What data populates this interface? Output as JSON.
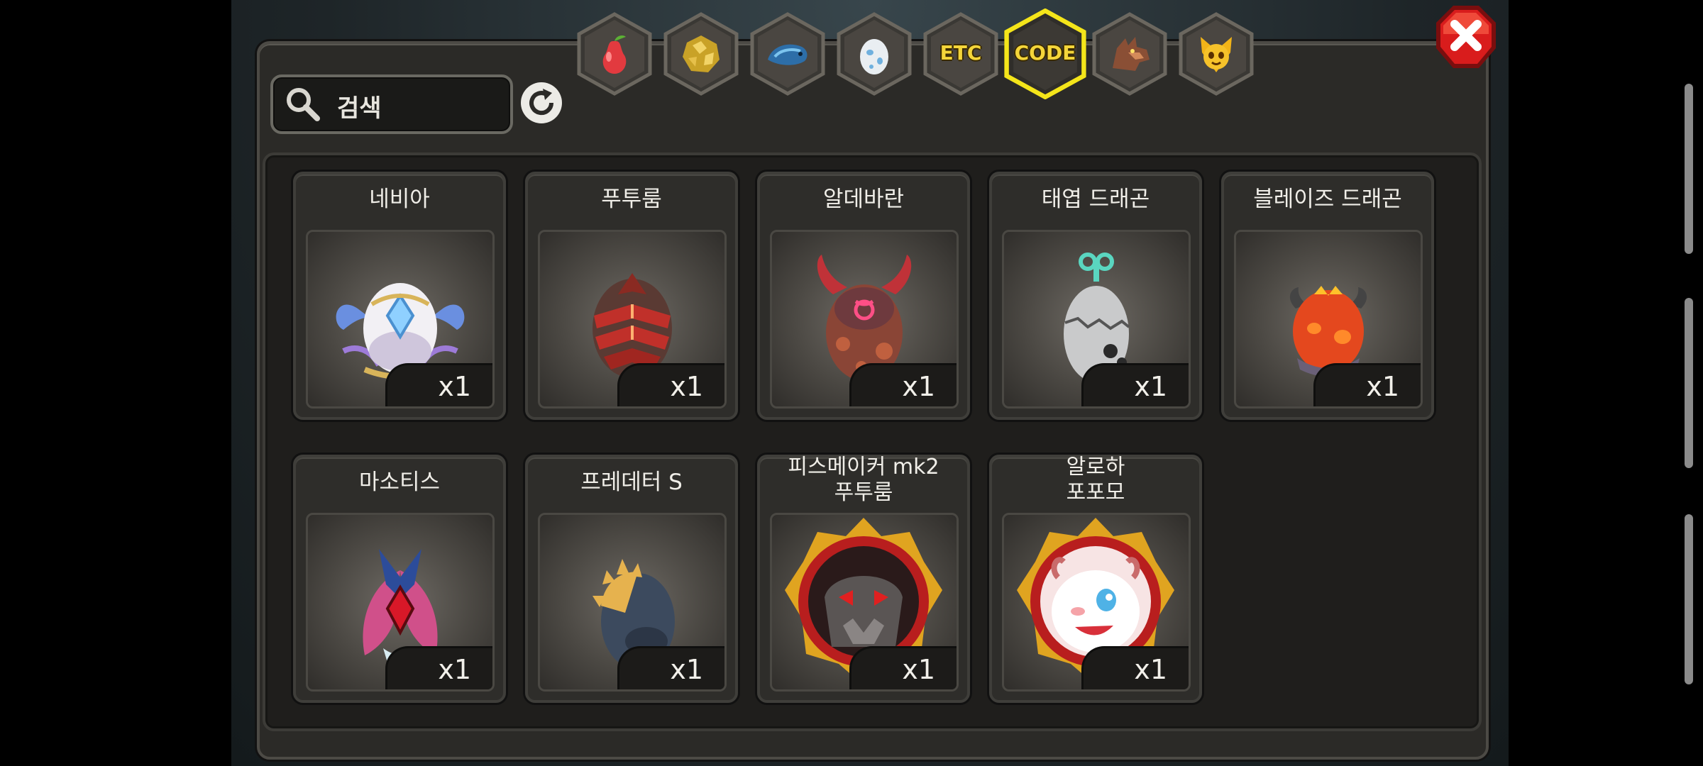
{
  "search": {
    "placeholder": "검색"
  },
  "tabs": [
    {
      "name": "tab-fruit",
      "icon": "pear-fruit-icon",
      "label": ""
    },
    {
      "name": "tab-gold",
      "icon": "gold-ore-icon",
      "label": ""
    },
    {
      "name": "tab-fish",
      "icon": "blue-fish-icon",
      "label": ""
    },
    {
      "name": "tab-egg",
      "icon": "spotted-egg-icon",
      "label": ""
    },
    {
      "name": "tab-etc",
      "icon": "",
      "label": "ETC"
    },
    {
      "name": "tab-code",
      "icon": "",
      "label": "CODE",
      "selected": true
    },
    {
      "name": "tab-dragon",
      "icon": "dragon-head-icon",
      "label": ""
    },
    {
      "name": "tab-creature",
      "icon": "yellow-creature-icon",
      "label": ""
    }
  ],
  "items": [
    {
      "name": "네비아",
      "count": "x1",
      "icon": "winged-crystal-egg"
    },
    {
      "name": "푸투룸",
      "count": "x1",
      "icon": "red-spiked-egg"
    },
    {
      "name": "알데바란",
      "count": "x1",
      "icon": "horned-taurus-egg"
    },
    {
      "name": "태엽 드래곤",
      "count": "x1",
      "icon": "clockwork-egg"
    },
    {
      "name": "블레이즈 드래곤",
      "count": "x1",
      "icon": "flame-dragon-egg"
    },
    {
      "name": "마소티스",
      "count": "x1",
      "icon": "winged-gem-egg"
    },
    {
      "name": "프레데터 S",
      "count": "x1",
      "icon": "spiked-dark-egg"
    },
    {
      "name": "피스메이커 mk2\n푸투룸",
      "count": "x1",
      "icon": "peacemaker-medal"
    },
    {
      "name": "알로하\n포포모",
      "count": "x1",
      "icon": "popomo-medal"
    }
  ],
  "colors": {
    "selected_tab": "#f4e51a",
    "close_button": "#d91c1c",
    "label_text": "#f0eee8"
  }
}
